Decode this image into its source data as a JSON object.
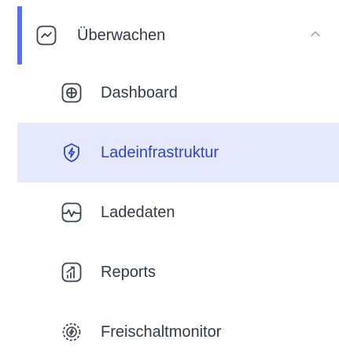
{
  "colors": {
    "accent": "#5b6ef5",
    "active_background": "#e6e9fc",
    "active_text": "#2f44d6",
    "text": "#333a45",
    "icon": "#3c4350",
    "chevron": "#9aa0aa"
  },
  "section": {
    "label": "Überwachen",
    "icon": "trend-line-icon",
    "expanded": true
  },
  "items": [
    {
      "label": "Dashboard",
      "icon": "grid-plus-icon",
      "active": false
    },
    {
      "label": "Ladeinfrastruktur",
      "icon": "charging-shield-icon",
      "active": true
    },
    {
      "label": "Ladedaten",
      "icon": "pulse-monitor-icon",
      "active": false
    },
    {
      "label": "Reports",
      "icon": "bar-chart-icon",
      "active": false
    },
    {
      "label": "Freischaltmonitor",
      "icon": "unlock-gear-icon",
      "active": false
    }
  ]
}
